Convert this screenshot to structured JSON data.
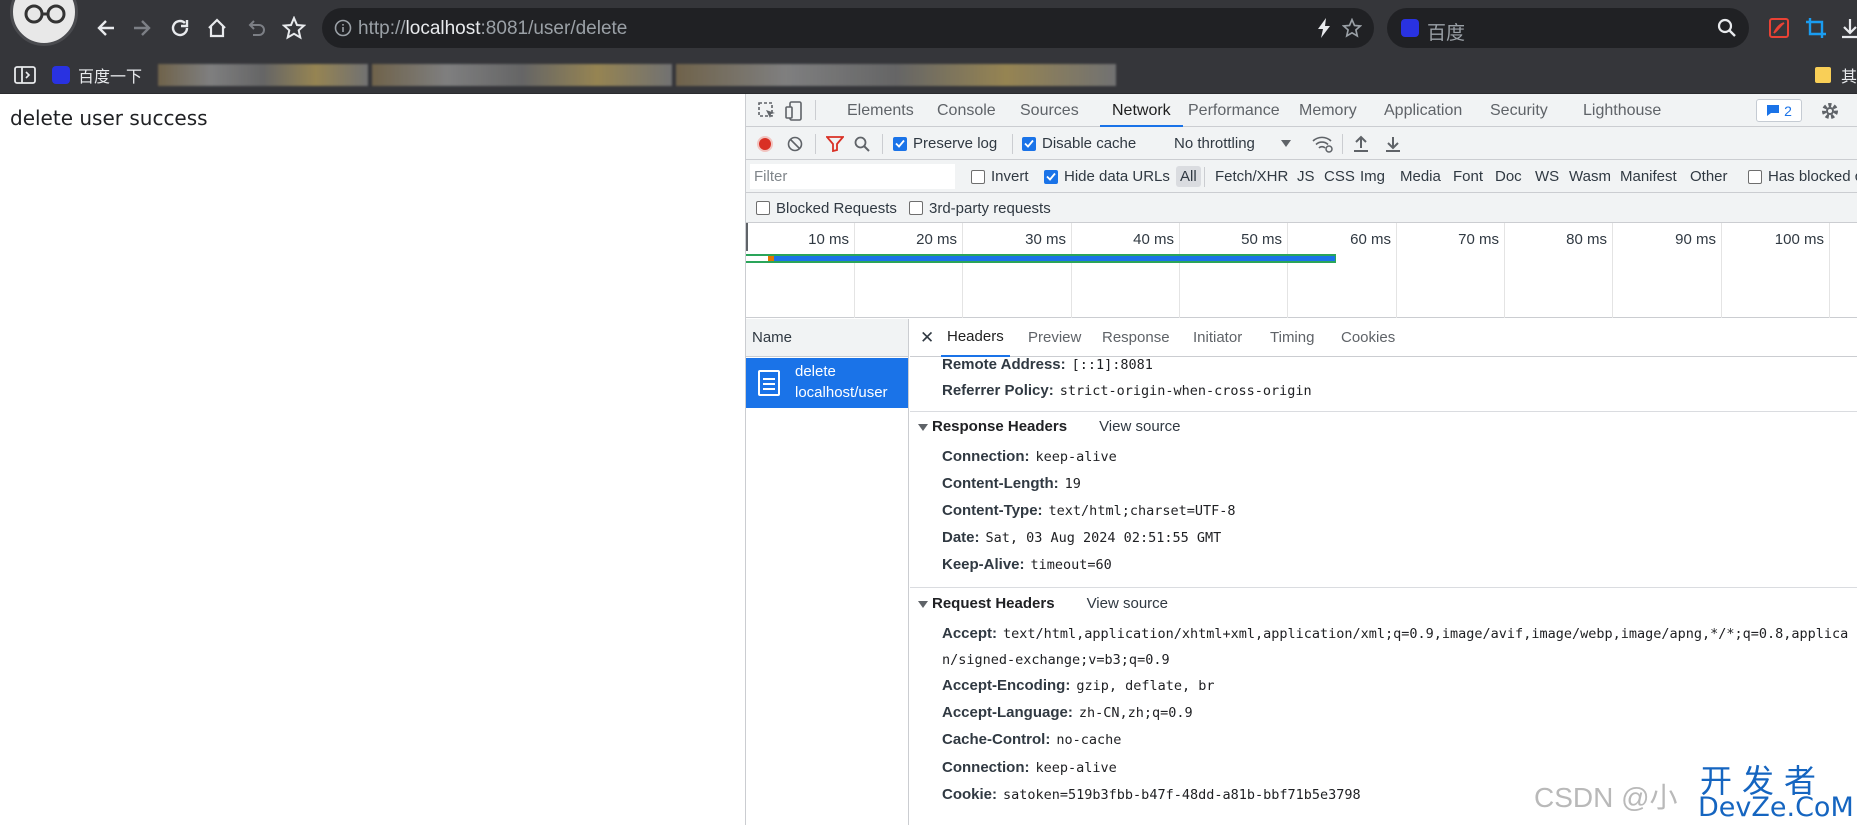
{
  "browser": {
    "url_prefix": "http://",
    "url_host": "localhost",
    "url_rest": ":8081/user/delete",
    "search_placeholder": "百度",
    "bookmarks": [
      {
        "label": "百度一下"
      },
      {
        "label": "其"
      }
    ]
  },
  "page": {
    "body_text": "delete user success"
  },
  "devtools": {
    "tabs": [
      "Elements",
      "Console",
      "Sources",
      "Network",
      "Performance",
      "Memory",
      "Application",
      "Security",
      "Lighthouse"
    ],
    "issues_count": "2",
    "toolbar": {
      "preserve_log": "Preserve log",
      "disable_cache": "Disable cache",
      "throttling": "No throttling"
    },
    "filter_bar": {
      "filter_placeholder": "Filter",
      "invert": "Invert",
      "hide_data_urls": "Hide data URLs",
      "types": [
        "All",
        "Fetch/XHR",
        "JS",
        "CSS",
        "Img",
        "Media",
        "Font",
        "Doc",
        "WS",
        "Wasm",
        "Manifest",
        "Other"
      ],
      "has_blocked": "Has blocked c"
    },
    "third_bar": {
      "blocked_requests": "Blocked Requests",
      "third_party": "3rd-party requests"
    },
    "timeline": {
      "ticks": [
        "10 ms",
        "20 ms",
        "30 ms",
        "40 ms",
        "50 ms",
        "60 ms",
        "70 ms",
        "80 ms",
        "90 ms",
        "100 ms"
      ]
    },
    "requests": {
      "column_name": "Name",
      "items": [
        {
          "name": "delete",
          "path": "localhost/user"
        }
      ]
    },
    "detail": {
      "tabs": [
        "Headers",
        "Preview",
        "Response",
        "Initiator",
        "Timing",
        "Cookies"
      ],
      "general": [
        {
          "k": "Remote Address:",
          "v": "[::1]:8081"
        },
        {
          "k": "Referrer Policy:",
          "v": "strict-origin-when-cross-origin"
        }
      ],
      "response_title": "Response Headers",
      "view_source": "View source",
      "response_headers": [
        {
          "k": "Connection:",
          "v": "keep-alive"
        },
        {
          "k": "Content-Length:",
          "v": "19"
        },
        {
          "k": "Content-Type:",
          "v": "text/html;charset=UTF-8"
        },
        {
          "k": "Date:",
          "v": "Sat, 03 Aug 2024 02:51:55 GMT"
        },
        {
          "k": "Keep-Alive:",
          "v": "timeout=60"
        }
      ],
      "request_title": "Request Headers",
      "accept_key": "Accept:",
      "accept_line1": "text/html,application/xhtml+xml,application/xml;q=0.9,image/avif,image/webp,image/apng,*/*;q=0.8,applica",
      "accept_line2": "n/signed-exchange;v=b3;q=0.9",
      "request_headers": [
        {
          "k": "Accept-Encoding:",
          "v": "gzip, deflate, br"
        },
        {
          "k": "Accept-Language:",
          "v": "zh-CN,zh;q=0.9"
        },
        {
          "k": "Cache-Control:",
          "v": "no-cache"
        },
        {
          "k": "Connection:",
          "v": "keep-alive"
        },
        {
          "k": "Cookie:",
          "v": "satoken=519b3fbb-b47f-48dd-a81b-bbf71b5e3798"
        }
      ]
    }
  },
  "watermark": {
    "csdn": "CSDN @小",
    "cn": "开发者",
    "en": "DevZe.CoM"
  }
}
